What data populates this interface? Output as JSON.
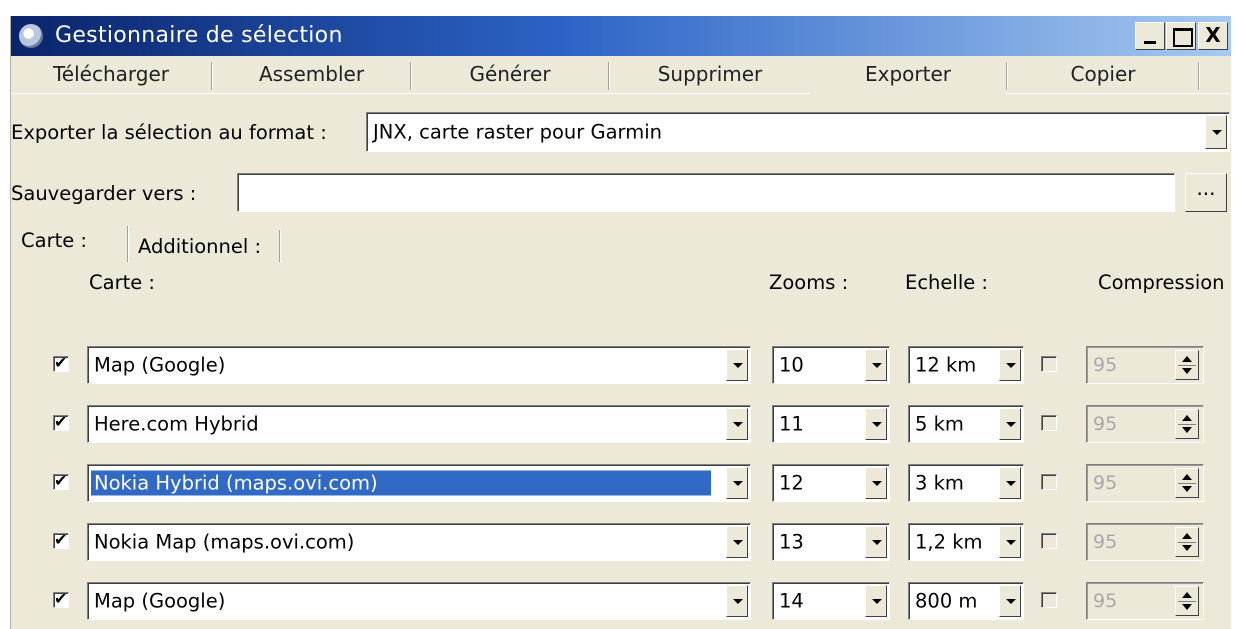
{
  "window": {
    "title": "Gestionnaire de sélection",
    "controls": [
      "_",
      "",
      "X"
    ]
  },
  "tabs": [
    "Télécharger",
    "Assembler",
    "Générer",
    "Supprimer",
    "Exporter",
    "Copier"
  ],
  "active_tab": "Exporter",
  "export": {
    "format_label": "Exporter la sélection au format :",
    "format_value": "JNX, carte raster pour Garmin",
    "save_label": "Sauvegarder vers :",
    "save_value": "",
    "browse_label": "..."
  },
  "inner_tabs": [
    "Carte :",
    "Additionnel :"
  ],
  "columns": {
    "map": "Carte :",
    "zooms": "Zooms :",
    "scale": "Echelle :",
    "compression": "Compression"
  },
  "rows": [
    {
      "checked": true,
      "map": "Map (Google)",
      "zoom": "10",
      "scale": "12 km",
      "compress_checked": false,
      "compression": "95",
      "selected": false
    },
    {
      "checked": true,
      "map": "Here.com Hybrid",
      "zoom": "11",
      "scale": "5 km",
      "compress_checked": false,
      "compression": "95",
      "selected": false
    },
    {
      "checked": true,
      "map": "Nokia Hybrid (maps.ovi.com)",
      "zoom": "12",
      "scale": "3 km",
      "compress_checked": false,
      "compression": "95",
      "selected": true
    },
    {
      "checked": true,
      "map": "Nokia Map (maps.ovi.com)",
      "zoom": "13",
      "scale": "1,2 km",
      "compress_checked": false,
      "compression": "95",
      "selected": false
    },
    {
      "checked": true,
      "map": "Map (Google)",
      "zoom": "14",
      "scale": "800 m",
      "compress_checked": false,
      "compression": "95",
      "selected": false
    }
  ],
  "colors": {
    "titlebar_start": "#0a246a",
    "titlebar_end": "#a6caf0",
    "face": "#ece9d8",
    "selection": "#316ac5"
  }
}
